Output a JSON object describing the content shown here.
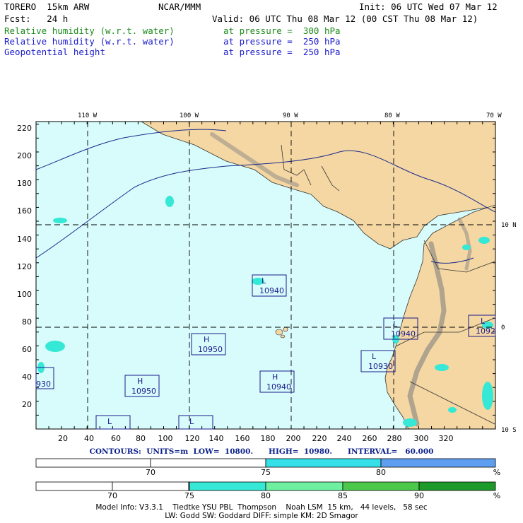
{
  "header": {
    "model": "TORERO  15km ARW",
    "org": "NCAR/MMM",
    "init": "Init: 06 UTC Wed 07 Mar 12",
    "fcst": "Fcst:   24 h",
    "valid": "Valid: 06 UTC Thu 08 Mar 12 (00 CST Thu 08 Mar 12)"
  },
  "fields": [
    {
      "name": "Relative humidity (w.r.t. water)",
      "level": "at pressure =  300 hPa",
      "color": "#1a8a1a"
    },
    {
      "name": "Relative humidity (w.r.t. water)",
      "level": "at pressure =  250 hPa",
      "color": "#1a1acc"
    },
    {
      "name": "Geopotential height",
      "level": "at pressure =  250 hPa",
      "color": "#1a1acc"
    }
  ],
  "map": {
    "lon_labels": [
      "110 W",
      "100 W",
      "90 W",
      "80 W",
      "70 W"
    ],
    "lat_labels": [
      "10 N",
      "0",
      "10 S"
    ],
    "y_ticks": [
      "220",
      "200",
      "180",
      "160",
      "140",
      "120",
      "100",
      "80",
      "60",
      "40",
      "20"
    ],
    "x_ticks": [
      "20",
      "40",
      "60",
      "80",
      "100",
      "120",
      "140",
      "160",
      "180",
      "200",
      "220",
      "240",
      "260",
      "280",
      "300",
      "320"
    ],
    "ocean_color": "#d8fcfc",
    "land_color": "#f4d7a3",
    "centers": [
      {
        "type": "L",
        "value": "10940"
      },
      {
        "type": "H",
        "value": "10950"
      },
      {
        "type": "H",
        "value": "10950"
      },
      {
        "type": "H",
        "value": "10940"
      },
      {
        "type": "L",
        "value": "10940"
      },
      {
        "type": "L",
        "value": "10930"
      },
      {
        "type": "L",
        "value": "1092"
      },
      {
        "type": "",
        "value": "930"
      },
      {
        "type": "L",
        "value": ""
      },
      {
        "type": "L",
        "value": ""
      }
    ]
  },
  "contours_line": "CONTOURS:  UNITS=m  LOW=  10800.      HIGH=  10980.      INTERVAL=   60.000",
  "colorbar1": {
    "labels": [
      "70",
      "75",
      "80",
      "%"
    ],
    "colors": [
      "#ffffff",
      "#ffffff",
      "#36e0e8",
      "#5e9ef0"
    ]
  },
  "colorbar2": {
    "labels": [
      "70",
      "75",
      "80",
      "85",
      "90",
      "%"
    ],
    "colors": [
      "#ffffff",
      "#ffffff",
      "#ffffff",
      "#36e8d6",
      "#6ef0a0",
      "#4cc84a",
      "#1e9a2a"
    ]
  },
  "model_info": {
    "line1": "Model Info: V3.3.1    Tiedtke YSU PBL  Thompson    Noah LSM  15 km,   44 levels,   58 sec",
    "line2": "LW: Godd SW: Goddard DIFF: simple KM: 2D Smagor"
  }
}
